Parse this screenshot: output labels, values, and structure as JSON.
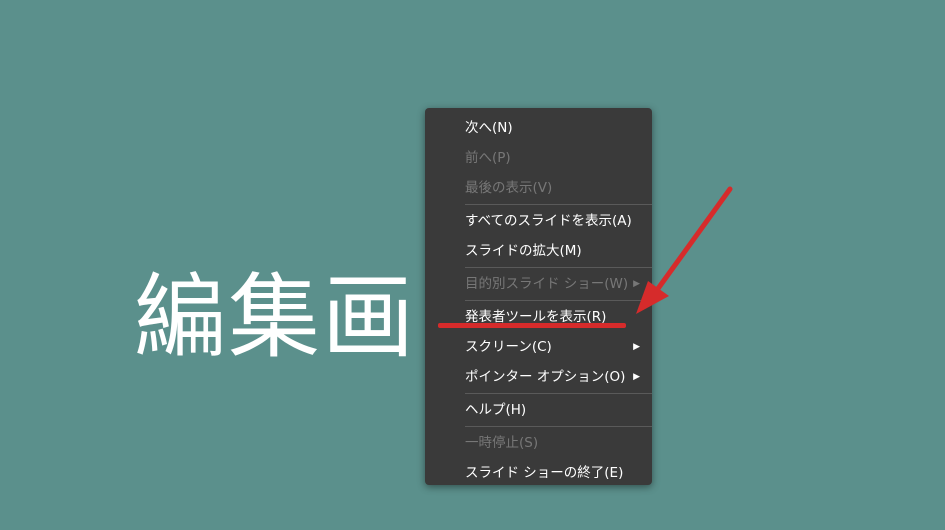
{
  "slide": {
    "title": "編集画"
  },
  "menu": {
    "groups": [
      [
        {
          "label": "次へ(N)",
          "enabled": true
        },
        {
          "label": "前へ(P)",
          "enabled": false
        },
        {
          "label": "最後の表示(V)",
          "enabled": false
        }
      ],
      [
        {
          "label": "すべてのスライドを表示(A)",
          "enabled": true
        },
        {
          "label": "スライドの拡大(M)",
          "enabled": true
        }
      ],
      [
        {
          "label": "目的別スライド ショー(W)",
          "enabled": false,
          "submenu": true
        }
      ],
      [
        {
          "label": "発表者ツールを表示(R)",
          "enabled": true
        },
        {
          "label": "スクリーン(C)",
          "enabled": true,
          "submenu": true
        },
        {
          "label": "ポインター オプション(O)",
          "enabled": true,
          "submenu": true
        }
      ],
      [
        {
          "label": "ヘルプ(H)",
          "enabled": true
        }
      ],
      [
        {
          "label": "一時停止(S)",
          "enabled": false
        },
        {
          "label": "スライド ショーの終了(E)",
          "enabled": true
        }
      ]
    ],
    "submenu_glyph": "▶"
  },
  "annotation": {
    "color": "#d62b2b",
    "icon": "red-arrow-icon"
  }
}
